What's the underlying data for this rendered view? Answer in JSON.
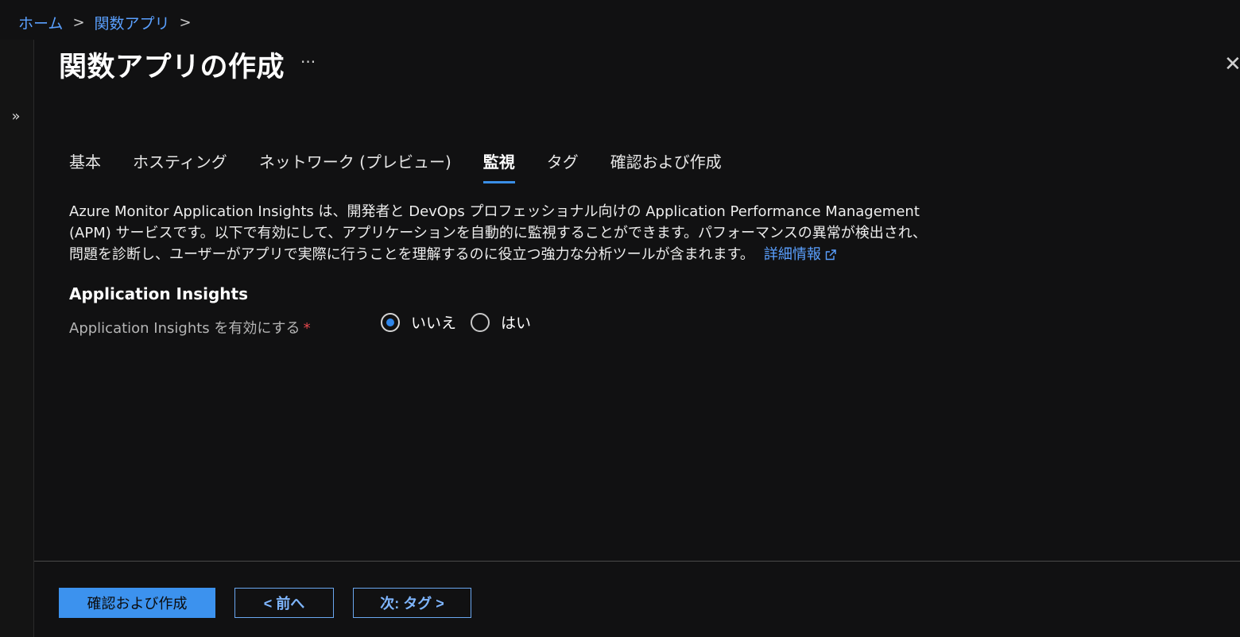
{
  "breadcrumb": {
    "home": "ホーム",
    "function_apps": "関数アプリ",
    "separator": ">"
  },
  "page": {
    "title": "関数アプリの作成",
    "more": "···"
  },
  "tabs": [
    {
      "label": "基本"
    },
    {
      "label": "ホスティング"
    },
    {
      "label": "ネットワーク (プレビュー)"
    },
    {
      "label": "監視"
    },
    {
      "label": "タグ"
    },
    {
      "label": "確認および作成"
    }
  ],
  "active_tab": "監視",
  "description": {
    "text": "Azure Monitor Application Insights は、開発者と DevOps プロフェッショナル向けの Application Performance Management (APM) サービスです。以下で有効にして、アプリケーションを自動的に監視することができます。パフォーマンスの異常が検出され、問題を診断し、ユーザーがアプリで実際に行うことを理解するのに役立つ強力な分析ツールが含まれます。",
    "link": "詳細情報"
  },
  "section": {
    "title": "Application Insights",
    "field_label": "Application Insights を有効にする",
    "required_mark": "*",
    "options": [
      {
        "label": "いいえ",
        "checked": true
      },
      {
        "label": "はい",
        "checked": false
      }
    ]
  },
  "footer": {
    "review_create": "確認および作成",
    "previous": "< 前へ",
    "next": "次: タグ >"
  },
  "colors": {
    "accent": "#3c92ee",
    "link": "#5aa0ff",
    "background": "#111112"
  }
}
